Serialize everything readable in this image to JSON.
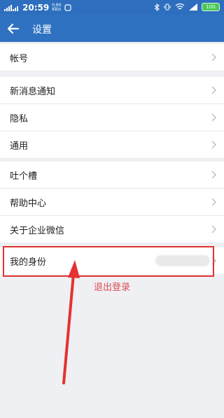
{
  "status_bar": {
    "time": "20:59",
    "speed_value": "0.60",
    "speed_unit": "KB/s",
    "battery": "100"
  },
  "header": {
    "title": "设置"
  },
  "settings": {
    "group1": [
      {
        "label": "帐号"
      }
    ],
    "group2": [
      {
        "label": "新消息通知"
      },
      {
        "label": "隐私"
      },
      {
        "label": "通用"
      }
    ],
    "group3": [
      {
        "label": "吐个槽"
      },
      {
        "label": "帮助中心"
      },
      {
        "label": "关于企业微信"
      }
    ],
    "group4": [
      {
        "label": "我的身份"
      }
    ]
  },
  "logout_label": "退出登录",
  "colors": {
    "accent": "#2f72c2",
    "logout": "#e14b55",
    "annotation": "#e53232"
  }
}
